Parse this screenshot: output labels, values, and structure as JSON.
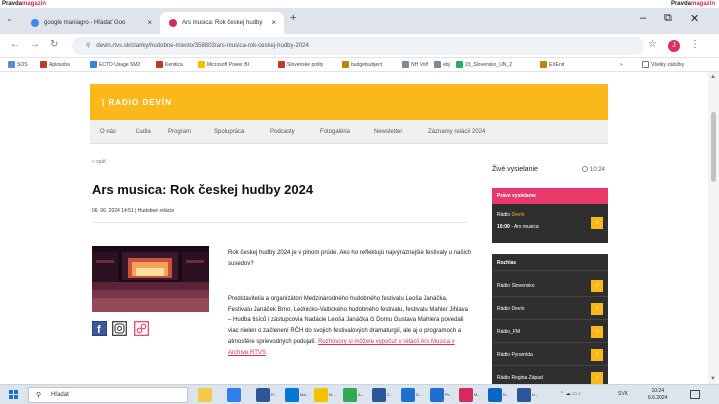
{
  "top_strip": {
    "left_prefix": "Pravda",
    "left_brand": "magazin",
    "right_prefix": "Pravda",
    "right_brand": "magazin"
  },
  "browser": {
    "tabs": [
      {
        "label": "google maniagro - Hľadať Goo",
        "favicon_color": "#4285f4"
      },
      {
        "label": "Ars musica: Rok českej hudby",
        "favicon_color": "#d62a5a"
      }
    ],
    "url": "devin.rtvs.sk/clanky/hudobne-miesto/358803/ars-musica-rok-ceskej-hudby-2024",
    "profile_initial": "J",
    "bookmarks": [
      {
        "label": "SOS",
        "color": "#5b8ad6"
      },
      {
        "label": "Aplosoba",
        "color": "#c0392b"
      },
      {
        "label": "ECTO Usage SM2",
        "color": "#2e86de"
      },
      {
        "label": "Kenitica",
        "color": "#c0392b"
      },
      {
        "label": "Microsoft Power BI",
        "color": "#f2c200"
      },
      {
        "label": "Slovenske pošty",
        "color": "#c0392b"
      },
      {
        "label": "budgetsubject",
        "color": "#b8860b"
      },
      {
        "label": "NH Volf",
        "color": "#7f8c8d"
      },
      {
        "label": "ebj",
        "color": "#7f8c8d"
      },
      {
        "label": "23_Slovensko_UN_2",
        "color": "#27ae60"
      },
      {
        "label": "EXEnit",
        "color": "#b8860b"
      }
    ],
    "other_bookmarks": "Všetky záložky"
  },
  "site": {
    "logo": "| RADIO DEVÍN",
    "menu": [
      "O nás",
      "Ľudia",
      "Program",
      "Spolupráca",
      "Podcasty",
      "Fotogaléria",
      "Newsletter",
      "Záznamy relácií 2024"
    ]
  },
  "article": {
    "back": "« späť",
    "title": "Ars musica: Rok českej hudby 2024",
    "meta": "06. 06. 2024 14:51 | Hudobné relácie",
    "lead": "Rok českej hudby 2024 je v plnom prúde. Ako ho reflektujú najvýraznejšie festivaly u našich susedov?",
    "body": "Predstavitelia a organizátori Medzinárodného hudobného festivalu Leoša Janáčka, Festivalu Janáček Brno, Lednicko-Valtického hudobného festivalu, festivalu Mahler Jihlava – Hudba tisíců i zástupcovia Nadácie Leoša Janáčka či Domu Gustava Mahlera povedali viac nielen o začlenení RČH do svojich festivalových dramaturgií, ale aj o programoch a atmosfére sprievodných podujatí.",
    "link": "Rozhovory si môžete vypočuť v relácii Ars Musica v Archíve RTVS"
  },
  "sidebar": {
    "live_title": "Živé vysielanie",
    "live_time": "10:24",
    "now_heading": "Práve vysielame",
    "now_station_prefix": "Rádio",
    "now_station_name": "Devín",
    "now_time": "10:00",
    "now_show": "- Ars musica",
    "radio_heading": "Rozhlas",
    "stations": [
      "Rádio Slovensko",
      "Rádio Devín",
      "Rádio_FM",
      "Rádio Pyramída",
      "Rádio Regina Západ"
    ]
  },
  "taskbar": {
    "search_placeholder": "Hľadať",
    "apps": [
      {
        "label": "",
        "color": "#f2c94c"
      },
      {
        "label": "",
        "color": "#2f80ed"
      },
      {
        "label": "P...",
        "color": "#2b579a"
      },
      {
        "label": "Ma...",
        "color": "#0078d4"
      },
      {
        "label": "N...",
        "color": "#f2c200"
      },
      {
        "label": "A...",
        "color": "#34a853"
      },
      {
        "label": "C...",
        "color": "#2b579a"
      },
      {
        "label": "D...",
        "color": "#1f6fd1"
      },
      {
        "label": "Pr...",
        "color": "#1f6fd1"
      },
      {
        "label": "M...",
        "color": "#d62a5a"
      },
      {
        "label": "N...",
        "color": "#0a66c2"
      },
      {
        "label": "U...",
        "color": "#2b579a"
      }
    ],
    "lang": "SVK",
    "time": "10:24",
    "date": "6.6.2024"
  }
}
